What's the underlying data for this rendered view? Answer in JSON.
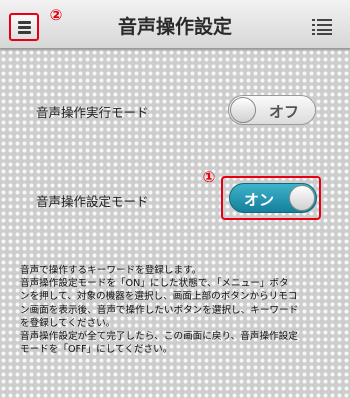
{
  "header": {
    "title": "音声操作設定",
    "menu_marker": "②",
    "menu_icon": "hamburger-menu-icon",
    "list_icon": "list-view-icon"
  },
  "settings": [
    {
      "label": "音声操作実行モード",
      "state": "オフ",
      "on": false
    },
    {
      "label": "音声操作設定モード",
      "state": "オン",
      "on": true,
      "marker": "①"
    }
  ],
  "description": [
    "音声で操作するキーワードを登録します。",
    "音声操作設定モードを「ON」にした状態で、「メニュー」ボタ",
    "ンを押して、対象の機器を選択し、画面上部のボタンからリモコ",
    "ン画面を表示後、音声で操作したいボタンを選択し、キーワード",
    "を登録してください。",
    "音声操作設定が全て完了したら、この画面に戻り、音声操作設定",
    "モードを「OFF」にしてください。"
  ],
  "colors": {
    "accent_toggle_on": "#1f93ad",
    "highlight_red": "#e60012"
  }
}
